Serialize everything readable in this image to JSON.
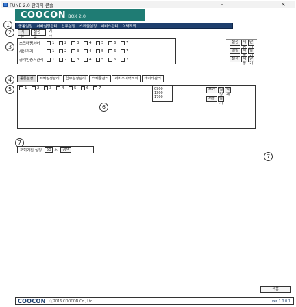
{
  "window": {
    "title": "FUNE 2.0 관리자 콘솔",
    "minimize": "–",
    "close": "×"
  },
  "brand": {
    "logo": "COOCON",
    "subtitle": "BOX 2.0"
  },
  "menubar": {
    "items": [
      "공통설정",
      "서버설정관리",
      "업무설정",
      "스케줄설정",
      "서비스관리",
      "이력조회"
    ]
  },
  "subtabs": [
    "기본",
    "설정값",
    "기타"
  ],
  "markers": [
    "1",
    "2",
    "3",
    "4",
    "5",
    "6",
    "7"
  ],
  "slots": {
    "rows": [
      {
        "label": "스크래핑서버",
        "items": [
          "1",
          "2",
          "3",
          "4",
          "5",
          "6",
          "7"
        ],
        "btn1": "설정",
        "btn2": "저장",
        "btn3": "닫기"
      },
      {
        "label": "세션관리",
        "items": [
          "1",
          "2",
          "3",
          "4",
          "5",
          "6",
          "7"
        ],
        "btn1": "설정",
        "btn2": "저장",
        "btn3": "닫기"
      },
      {
        "label": "공개인증서관리",
        "items": [
          "1",
          "2",
          "3",
          "4",
          "5",
          "6",
          "7"
        ],
        "btn1": "설정",
        "btn2": "저장",
        "btn3": "닫기"
      }
    ]
  },
  "tabs2": [
    "공통설정",
    "서버설정관리",
    "업무설정관리",
    "스케줄관리",
    "서비스이력조회",
    "데이터관리"
  ],
  "service": {
    "items": [
      "1",
      "2",
      "3",
      "4",
      "5",
      "6",
      "7"
    ],
    "times": [
      "0900",
      "1300",
      "1700"
    ],
    "btn1": "추가",
    "btn2": "설정",
    "btn3": "삭제",
    "btn4": "저장",
    "btn5": "닫기"
  },
  "filter": {
    "label": "조회기간 설정",
    "value": "50",
    "unit": "초",
    "button": "검색"
  },
  "apply_button": "적용",
  "footer": {
    "logo": "COOCON",
    "copyright": "ⓒ2016 COOCON Co., Ltd",
    "version": "ver 1.0.0.1"
  }
}
